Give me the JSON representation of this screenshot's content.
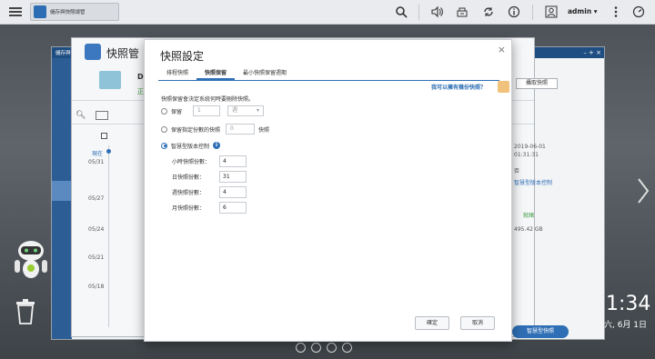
{
  "taskbar": {
    "app_tab_label": "儲存與快照總管",
    "user": "admin ▾"
  },
  "background_window": {
    "title": "儲存與快照總管",
    "header_prefix": "快照管",
    "snapshot_button": "攝取快照",
    "timeline_label": "現在",
    "dates": [
      "05/31",
      "05/27",
      "05/24",
      "05/21",
      "05/18"
    ],
    "right_date": "2019-06-01",
    "right_time": "01:31:31",
    "right_status1": "否",
    "right_link": "智慧型版本控制",
    "right_ok": "就緒",
    "right_size": "495.42 GB",
    "bottom_button": "智慧型快照",
    "left_icon_text": "D",
    "left_status": "正"
  },
  "clock": {
    "time": "1:34",
    "date": "六, 6月 1日"
  },
  "dialog": {
    "title": "快照設定",
    "tabs": [
      "排程快照",
      "快照保留",
      "最小快照保留週期"
    ],
    "active_tab": 1,
    "help_link": "我可以擁有幾份快照？",
    "description": "快照保留會決定系統何時要刪除快照。",
    "option1": {
      "label": "保留",
      "value": "1",
      "unit": "週"
    },
    "option2": {
      "label": "保留指定份數的快照",
      "value": "0",
      "unit": "快照"
    },
    "option3": {
      "label": "智慧型版本控制"
    },
    "fields": [
      {
        "label": "小時快照份數：",
        "value": "4"
      },
      {
        "label": "日快照份數：",
        "value": "31"
      },
      {
        "label": "週快照份數：",
        "value": "4"
      },
      {
        "label": "月快照份數：",
        "value": "6"
      }
    ],
    "confirm_label": "確定",
    "cancel_label": "取消"
  }
}
